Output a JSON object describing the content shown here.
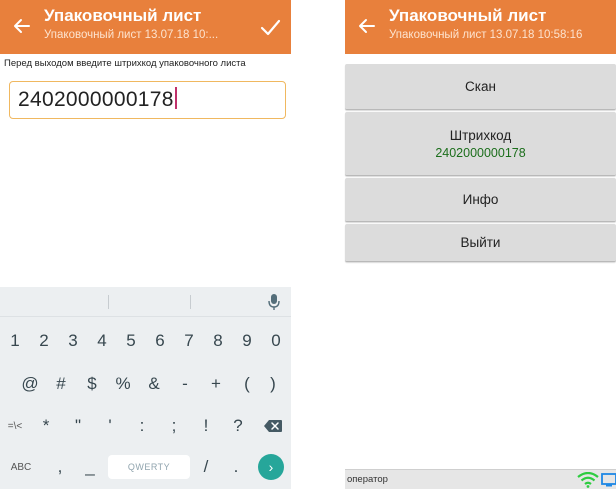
{
  "left_screen": {
    "header": {
      "title": "Упаковочный лист",
      "subtitle": "Упаковочный лист 13.07.18 10:..."
    },
    "prompt": "Перед выходом введите штрихкод упаковочного листа",
    "barcode_value": "2402000000178",
    "keyboard": {
      "row1": [
        "1",
        "2",
        "3",
        "4",
        "5",
        "6",
        "7",
        "8",
        "9",
        "0"
      ],
      "row2": [
        "@",
        "#",
        "$",
        "%",
        "&",
        "-",
        "+",
        "(",
        ")"
      ],
      "row3": [
        "=\\<",
        "*",
        "\"",
        "'",
        ":",
        ";",
        "!",
        "?"
      ],
      "row4": {
        "abc": "ABC",
        "comma": ",",
        "underscore": "_",
        "space": "QWERTY",
        "slash": "/",
        "period": ".",
        "go": "›"
      }
    }
  },
  "right_screen": {
    "header": {
      "title": "Упаковочный лист",
      "subtitle": "Упаковочный лист 13.07.18 10:58:16"
    },
    "menu": [
      {
        "label": "Скан",
        "value": ""
      },
      {
        "label": "Штрихкод",
        "value": "2402000000178"
      },
      {
        "label": "Инфо",
        "value": ""
      },
      {
        "label": "Выйти",
        "value": ""
      }
    ],
    "status": {
      "operator": "оператор"
    }
  },
  "colors": {
    "header_bg": "#e8803c",
    "input_border": "#f0b860",
    "button_bg": "#dcdcdc",
    "barcode_value_text": "#1b6e1b",
    "go_key": "#26a69a"
  },
  "icons": [
    "back-arrow-icon",
    "checkmark-icon",
    "microphone-icon",
    "backspace-icon",
    "wifi-icon",
    "screen-icon"
  ]
}
